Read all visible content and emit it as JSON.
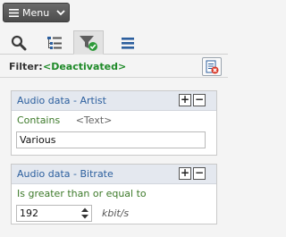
{
  "menu": {
    "label": "Menu"
  },
  "toolbar": {
    "tabs": [
      {
        "icon": "search-icon",
        "active": false
      },
      {
        "icon": "tree-list-icon",
        "active": false
      },
      {
        "icon": "filter-check-icon",
        "active": true
      },
      {
        "icon": "hamburger-list-icon",
        "active": false
      }
    ]
  },
  "filter": {
    "label": "Filter:",
    "value": "<Deactivated>"
  },
  "rules": [
    {
      "title": "Audio data - Artist",
      "operator": "Contains",
      "type": "<Text>",
      "value": "Various"
    },
    {
      "title": "Audio data - Bitrate",
      "operator": "Is greater than or equal to",
      "value": "192",
      "unit": "kbit/s"
    }
  ],
  "colors": {
    "accent": "#2c5f9e",
    "filter_value": "#1e8a28",
    "condition": "#3d7a2a"
  }
}
